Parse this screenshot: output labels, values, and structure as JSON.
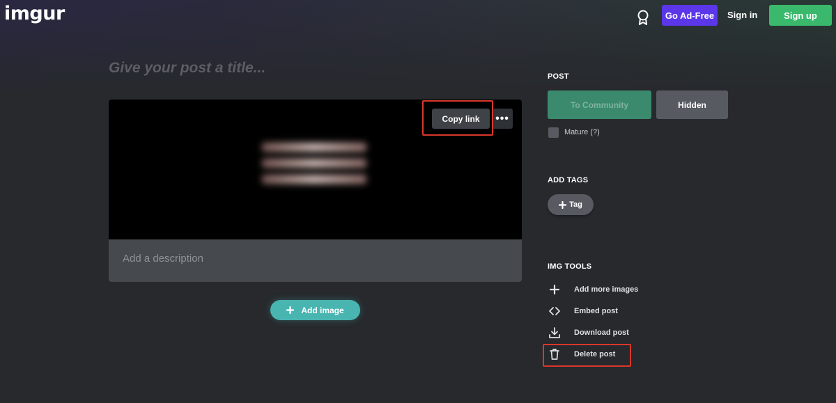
{
  "header": {
    "logo": "imgur",
    "adfree_label": "Go Ad-Free",
    "signin_label": "Sign in",
    "signup_label": "Sign up"
  },
  "editor": {
    "title_placeholder": "Give your post a title...",
    "copy_link_label": "Copy link",
    "more_label": "•••",
    "description_placeholder": "Add a description",
    "add_image_label": "Add image"
  },
  "sidebar": {
    "post_heading": "POST",
    "to_community_label": "To Community",
    "hidden_label": "Hidden",
    "mature_label": "Mature (?)",
    "tags_heading": "ADD TAGS",
    "tag_label": "Tag",
    "tools_heading": "IMG TOOLS",
    "tools": [
      {
        "label": "Add more images",
        "icon": "plus-icon"
      },
      {
        "label": "Embed post",
        "icon": "code-icon"
      },
      {
        "label": "Download post",
        "icon": "download-icon"
      },
      {
        "label": "Delete post",
        "icon": "trash-icon"
      }
    ]
  },
  "colors": {
    "background": "#27292d",
    "go_adfree": "#5b37e9",
    "sign_up": "#3ab96c",
    "add_image": "#48b5b1",
    "to_community": "#3b8a6e",
    "highlight": "#d9372a"
  }
}
